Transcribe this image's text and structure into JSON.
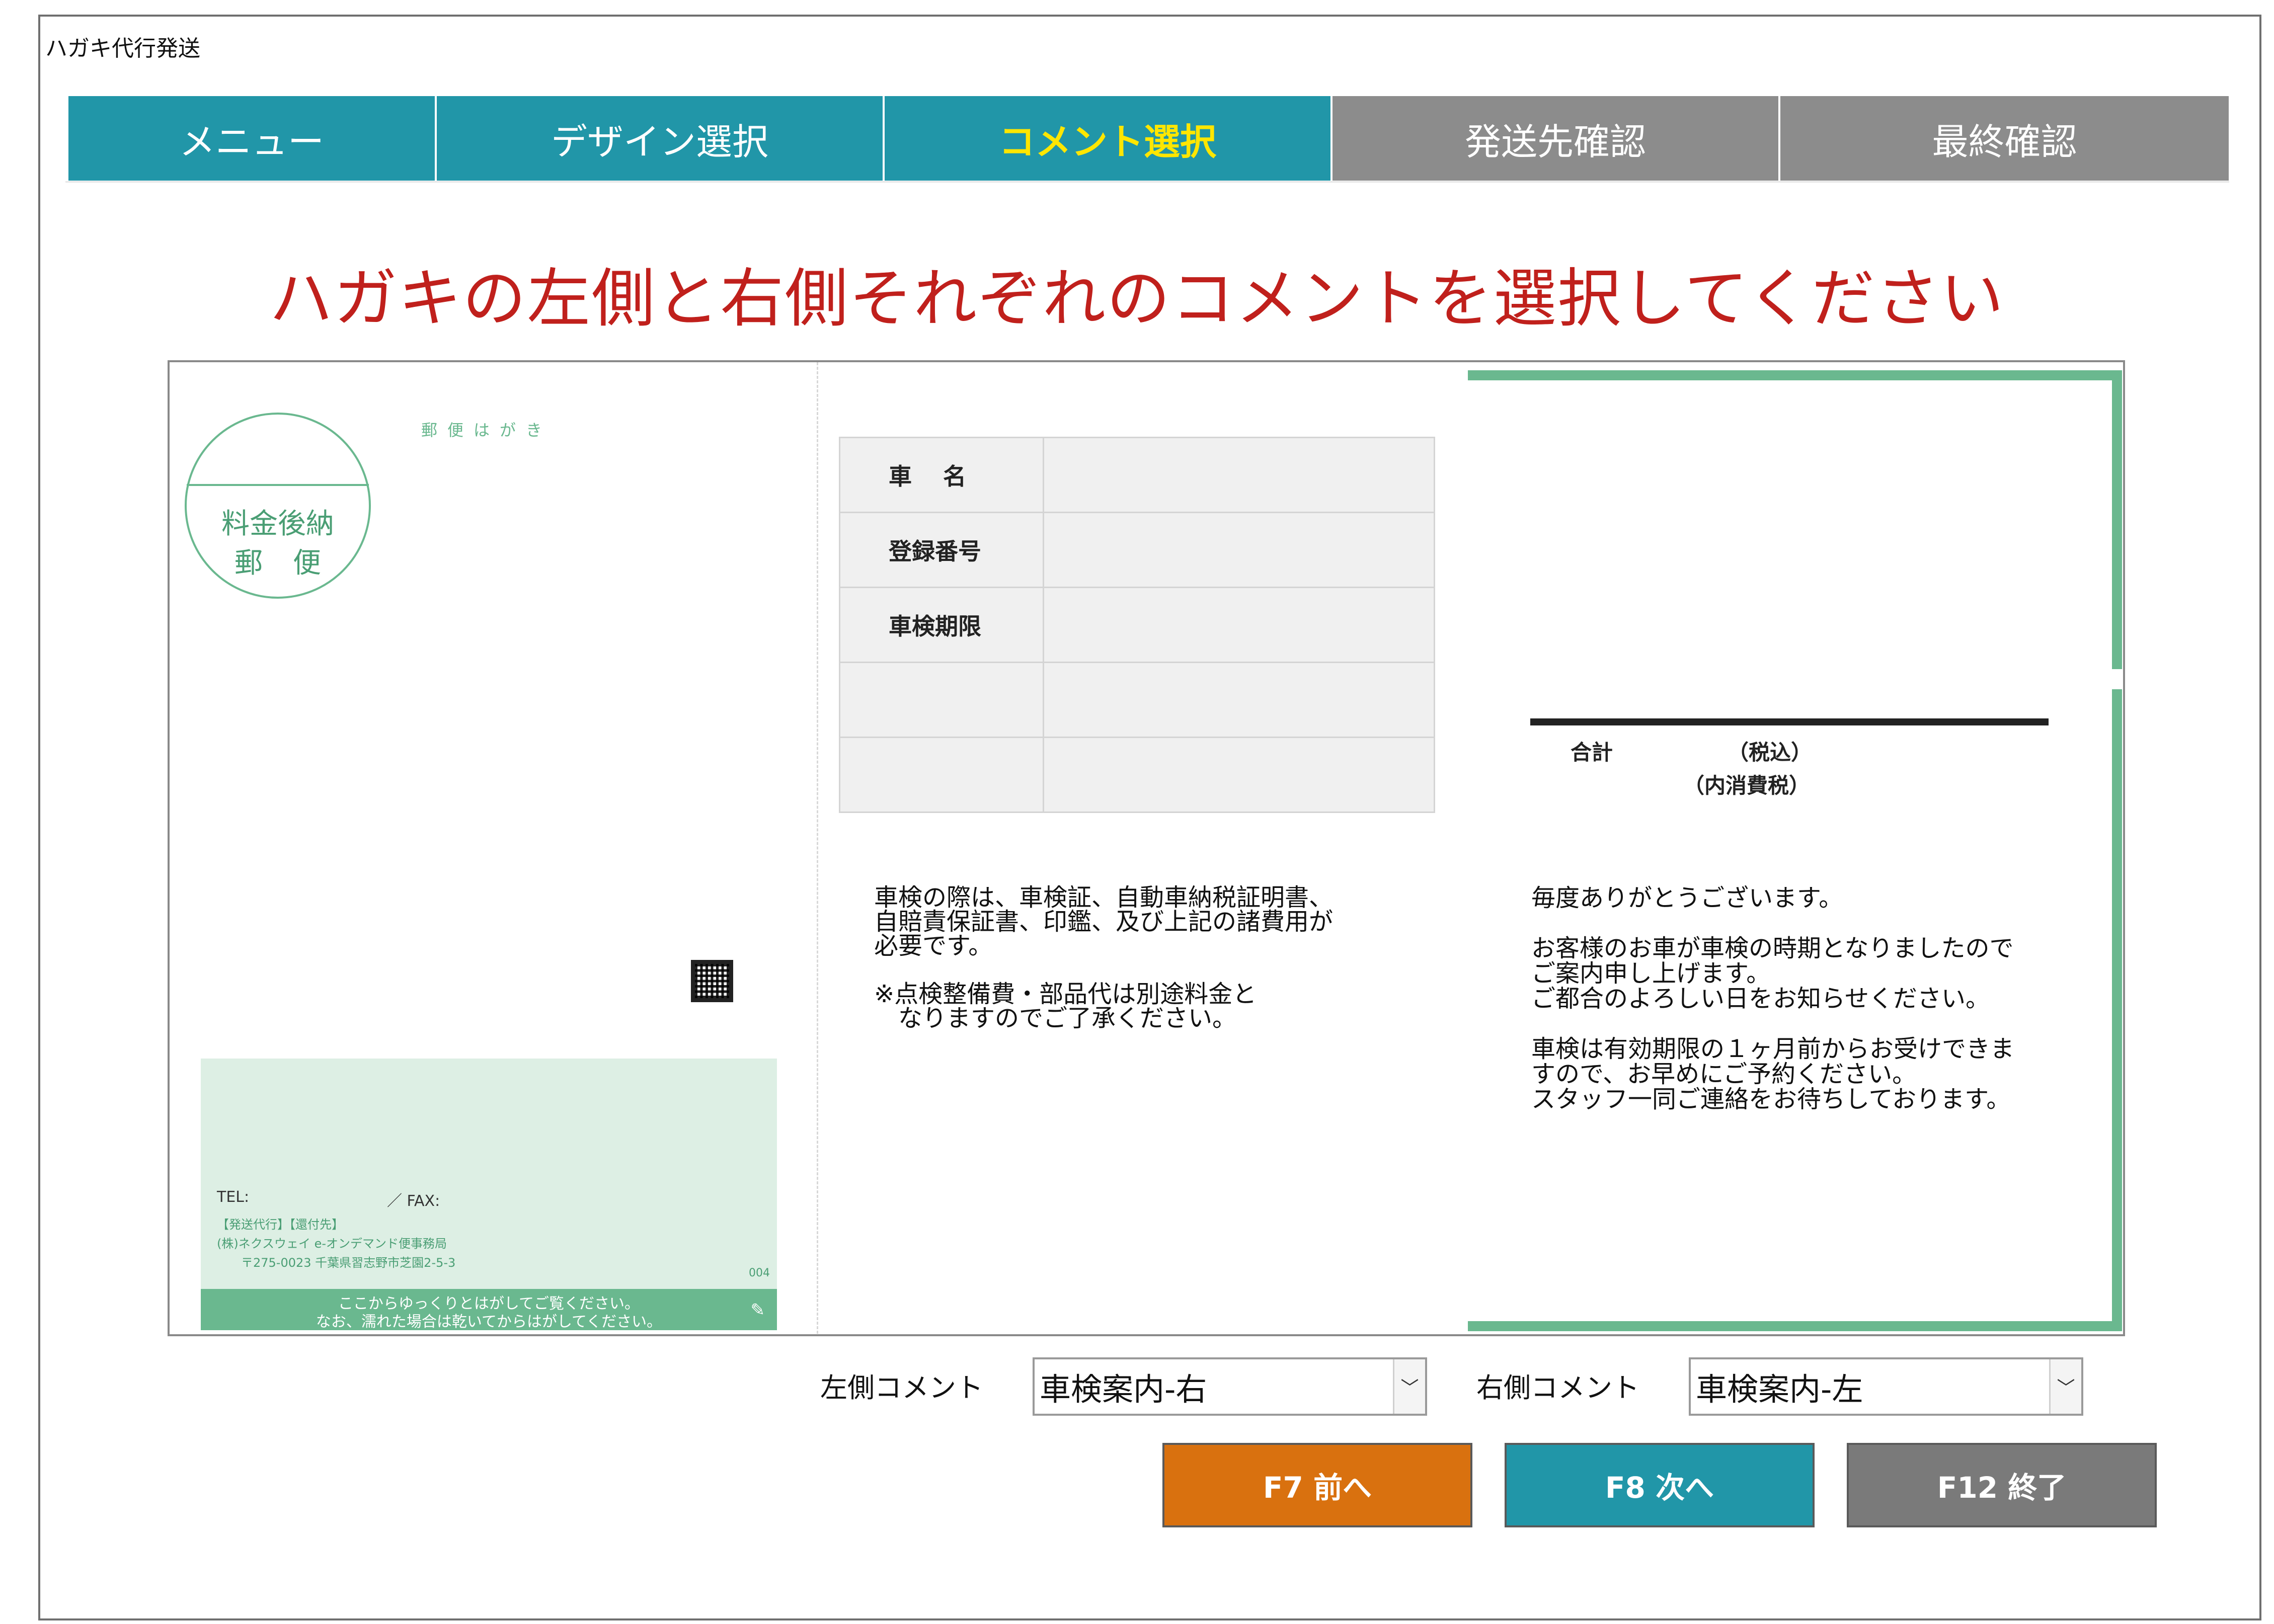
{
  "window": {
    "title": "ハガキ代行発送"
  },
  "tabs": [
    {
      "label": "メニュー",
      "state": "done"
    },
    {
      "label": "デザイン選択",
      "state": "done"
    },
    {
      "label": "コメント選択",
      "state": "active"
    },
    {
      "label": "発送先確認",
      "state": "pending"
    },
    {
      "label": "最終確認",
      "state": "pending"
    }
  ],
  "heading": "ハガキの左側と右側それぞれのコメントを選択してください",
  "postcard": {
    "stamp_line1": "料金後納",
    "stamp_line2": "郵便",
    "label": "郵便はがき",
    "sender": {
      "tel": "TEL:",
      "fax": "／ FAX:",
      "line1": "【発送代行】【還付先】",
      "line2": "(株)ネクスウェイ e-オンデマンド便事務局",
      "line3": "〒275-0023 千葉県習志野市芝園2-5-3",
      "number": "004",
      "peel1": "ここからゆっくりとはがしてご覧ください。",
      "peel2": "なお、濡れた場合は乾いてからはがしてください。"
    },
    "table": [
      {
        "label": "車　 名",
        "value": ""
      },
      {
        "label": "登録番号",
        "value": ""
      },
      {
        "label": "車検期限",
        "value": ""
      },
      {
        "label": "",
        "value": ""
      },
      {
        "label": "",
        "value": ""
      }
    ],
    "total_label": "合計",
    "tax_label": "（税込）",
    "tax_note": "（内消費税）",
    "left_comment": "車検の際は、車検証、自動車納税証明書、\n自賠責保証書、印鑑、及び上記の諸費用が\n必要です。\n\n※点検整備費・部品代は別途料金と\n　なりますのでご了承ください。",
    "right_comment": "毎度ありがとうございます。\n\nお客様のお車が車検の時期となりましたので\nご案内申し上げます。\nご都合のよろしい日をお知らせください。\n\n車検は有効期限の１ヶ月前からお受けできま\nすので、お早めにご予約ください。\nスタッフ一同ご連絡をお待ちしております。"
  },
  "controls": {
    "left_label": "左側コメント",
    "left_value": "車検案内-右",
    "right_label": "右側コメント",
    "right_value": "車検案内-左",
    "arrow": "﹀"
  },
  "buttons": {
    "prev": "F7 前へ",
    "next": "F8 次へ",
    "quit": "F12 終了"
  },
  "colors": {
    "teal": "#2196a8",
    "gray_tab": "#8c8c8c",
    "active_text": "#ffe600",
    "heading": "#c0201c",
    "green": "#6ab88f",
    "prev_button": "#d9710f"
  }
}
